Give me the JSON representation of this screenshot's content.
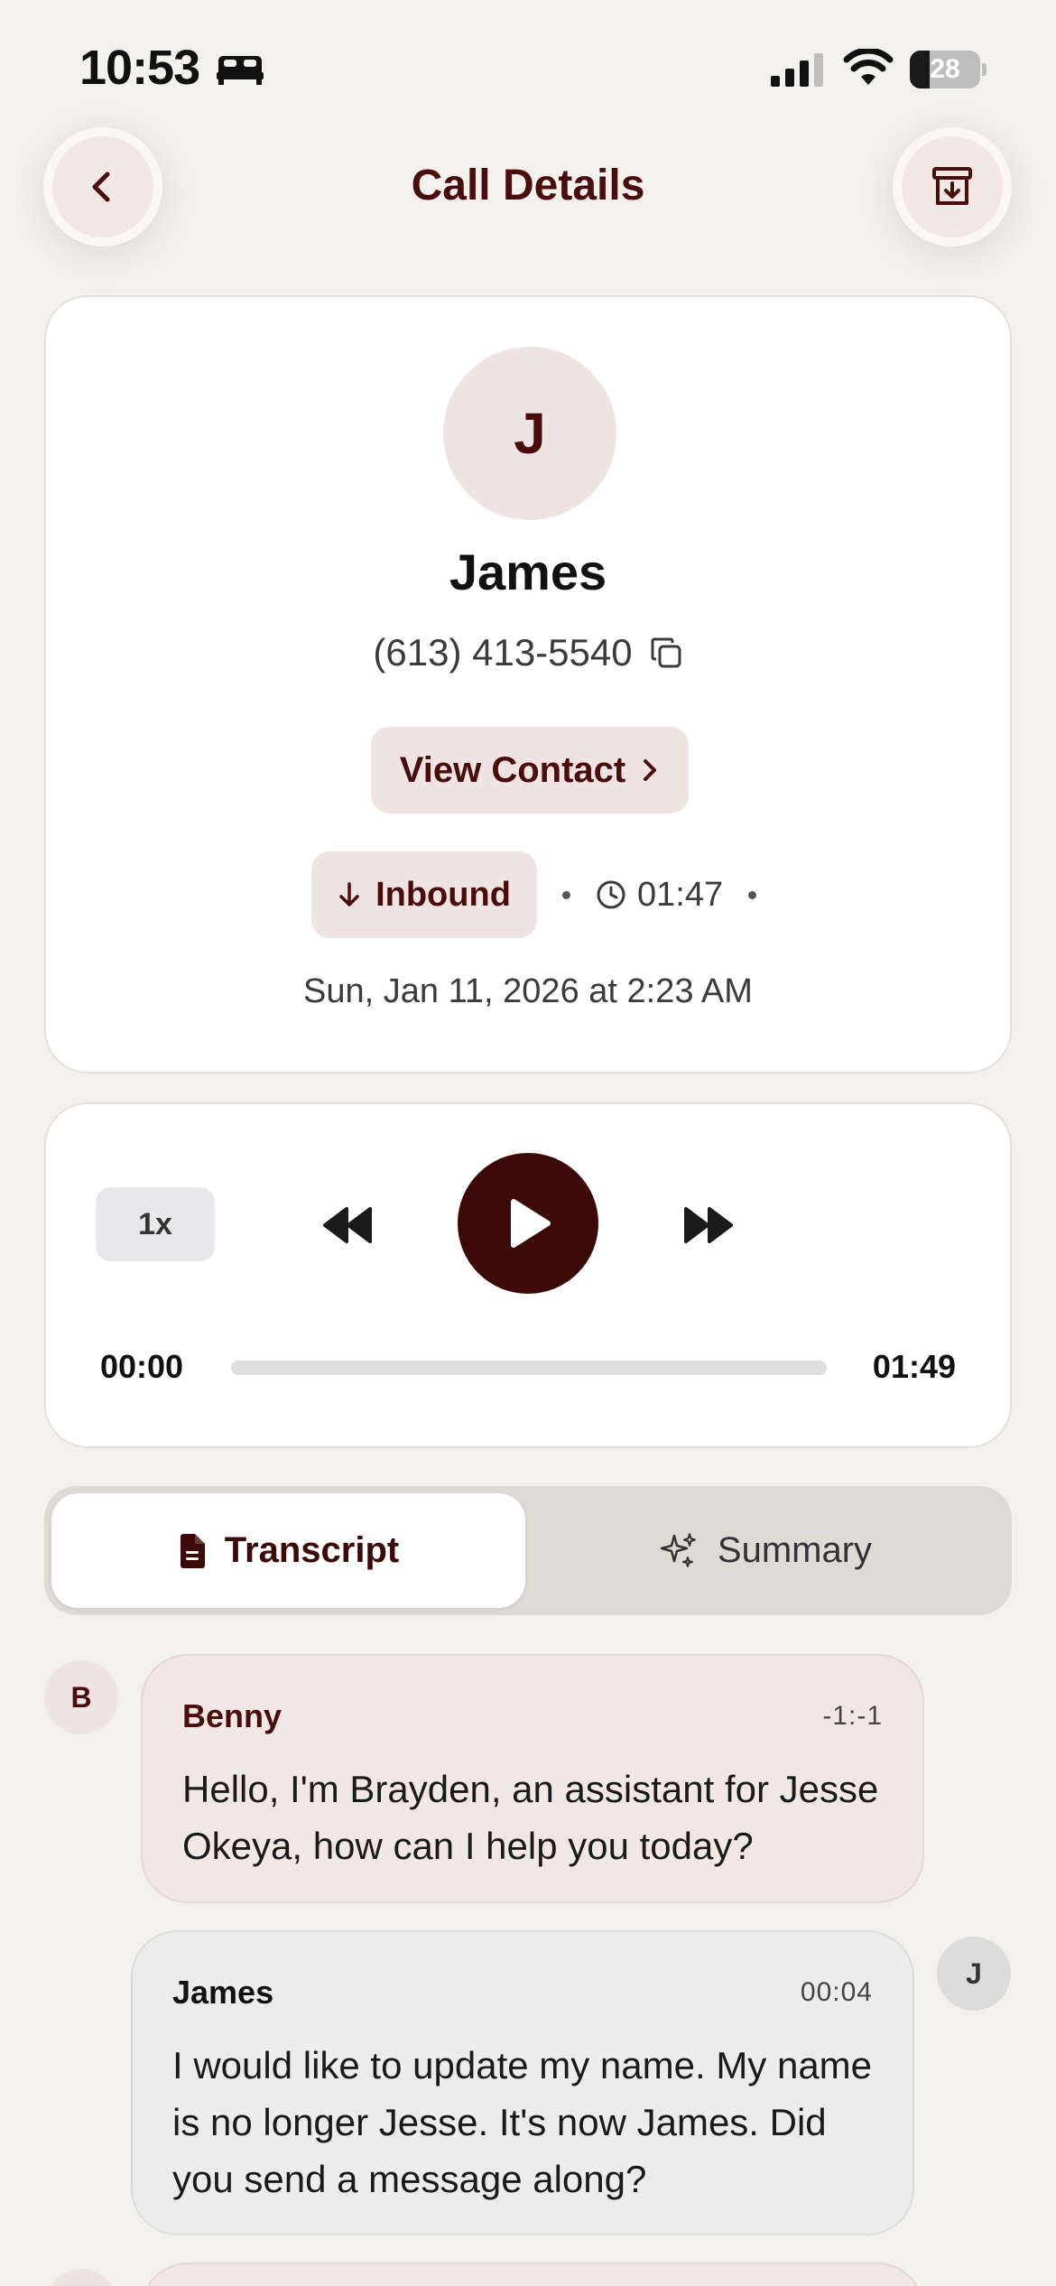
{
  "status_bar": {
    "time": "10:53",
    "battery": "28",
    "battery_level": 0.28
  },
  "header": {
    "title": "Call Details"
  },
  "contact": {
    "avatar_initial": "J",
    "name": "James",
    "phone": "(613) 413-5540",
    "view_contact_label": "View Contact",
    "direction": "Inbound",
    "duration": "01:47",
    "date": "Sun, Jan 11, 2026 at 2:23 AM"
  },
  "player": {
    "speed": "1x",
    "current_time": "00:00",
    "total_time": "01:49",
    "progress": 0
  },
  "tabs": [
    {
      "label": "Transcript",
      "active": true
    },
    {
      "label": "Summary",
      "active": false
    }
  ],
  "transcript": [
    {
      "speaker": "Benny",
      "initial": "B",
      "time": "-1:-1",
      "text": "Hello, I'm Brayden, an assistant for Jesse Okeya, how can I help you today?"
    },
    {
      "speaker": "James",
      "initial": "J",
      "time": "00:04",
      "text": "I would like to update my name. My name is no longer Jesse. It's now James. Did you send a message along?"
    }
  ],
  "colors": {
    "brand_dark": "#3d0808",
    "brand_text": "#4a0c0c",
    "agent_bubble": "#f1e8e6",
    "user_bubble": "#ececec",
    "background": "#f3f1ee"
  },
  "icons": {
    "back": "chevron-left-icon",
    "archive": "archive-box-icon",
    "copy": "copy-icon",
    "inbound": "arrow-down-icon",
    "clock": "clock-icon",
    "rewind": "rewind-icon",
    "play": "play-icon",
    "forward": "fast-forward-icon",
    "transcript": "document-icon",
    "summary": "sparkles-icon"
  }
}
